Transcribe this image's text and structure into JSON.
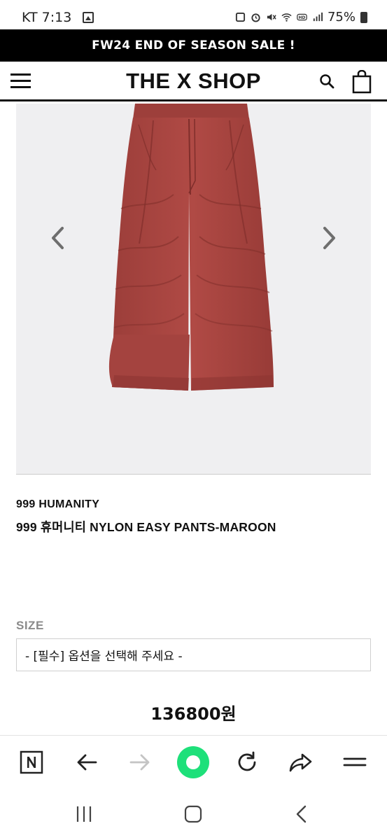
{
  "status_bar": {
    "carrier_time": "KT 7:13",
    "battery": "75%"
  },
  "promo_banner": {
    "text": "FW24 END OF SEASON SALE !"
  },
  "header": {
    "logo": "THE X SHOP"
  },
  "product": {
    "brand": "999 HUMANITY",
    "name": "999 휴머니티 NYLON EASY PANTS-MAROON",
    "image_color": "#a5433f",
    "size_label": "SIZE",
    "size_select_value": "- [필수] 옵션을 선택해 주세요 -",
    "price": "136800원"
  },
  "colors": {
    "accent_green": "#1ee07a",
    "banner_bg": "#000000",
    "image_bg": "#efeff1"
  }
}
